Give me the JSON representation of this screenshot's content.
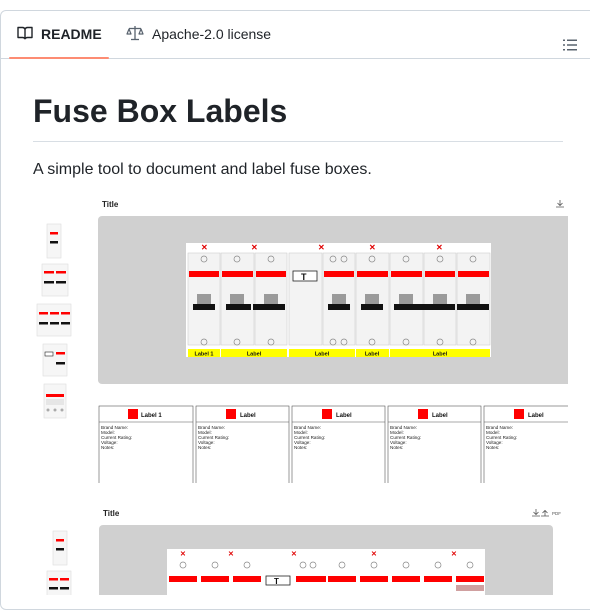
{
  "tabs": {
    "readme_label": "README",
    "license_label": "Apache-2.0 license"
  },
  "readme": {
    "heading": "Fuse Box Labels",
    "description": "A simple tool to document and label fuse boxes."
  },
  "preview1": {
    "title": "Title",
    "breaker_labels": [
      "Label 1",
      "Label",
      "Label",
      "Label",
      "Label"
    ],
    "cards": [
      {
        "title": "Label 1"
      },
      {
        "title": "Label"
      },
      {
        "title": "Label"
      },
      {
        "title": "Label"
      },
      {
        "title": "Label"
      }
    ],
    "card_fields": [
      "Brand Name:",
      "Model:",
      "Current Rating:",
      "Voltage:",
      "Notes:"
    ]
  },
  "preview2": {
    "title": "Title",
    "pdf_label": "PDF"
  },
  "colors": {
    "accent_underline": "#fd8c73",
    "breaker_red": "#ff0000",
    "label_yellow": "#ffff00",
    "canvas_grey": "#d0d0d0"
  }
}
